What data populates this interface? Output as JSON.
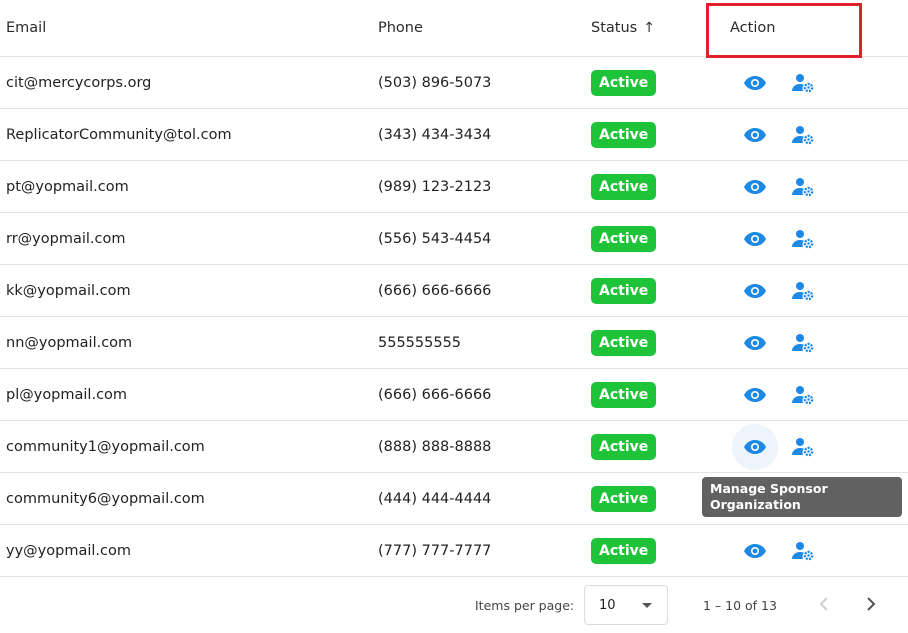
{
  "header": {
    "email": "Email",
    "phone": "Phone",
    "status": "Status",
    "status_sort": "↑",
    "action": "Action"
  },
  "rows": [
    {
      "email": "cit@mercycorps.org",
      "phone": "(503) 896-5073",
      "status": "Active"
    },
    {
      "email": "ReplicatorCommunity@tol.com",
      "phone": "(343) 434-3434",
      "status": "Active"
    },
    {
      "email": "pt@yopmail.com",
      "phone": "(989) 123-2123",
      "status": "Active"
    },
    {
      "email": "rr@yopmail.com",
      "phone": "(556) 543-4454",
      "status": "Active"
    },
    {
      "email": "kk@yopmail.com",
      "phone": "(666) 666-6666",
      "status": "Active"
    },
    {
      "email": "nn@yopmail.com",
      "phone": "555555555",
      "status": "Active"
    },
    {
      "email": "pl@yopmail.com",
      "phone": "(666) 666-6666",
      "status": "Active"
    },
    {
      "email": "community1@yopmail.com",
      "phone": "(888) 888-8888",
      "status": "Active"
    },
    {
      "email": "community6@yopmail.com",
      "phone": "(444) 444-4444",
      "status": "Active"
    },
    {
      "email": "yy@yopmail.com",
      "phone": "(777) 777-7777",
      "status": "Active"
    }
  ],
  "tooltip": {
    "text": "Manage Sponsor Organization"
  },
  "paginator": {
    "items_label": "Items per page:",
    "page_size": "10",
    "range": "1 – 10 of 13"
  },
  "colors": {
    "accent": "#1e88e5",
    "badge": "#1fc33a",
    "highlight": "#e0202a"
  },
  "icons": {
    "view": "eye-icon",
    "manage": "user-gear-icon",
    "prev": "chevron-left-icon",
    "next": "chevron-right-icon"
  }
}
